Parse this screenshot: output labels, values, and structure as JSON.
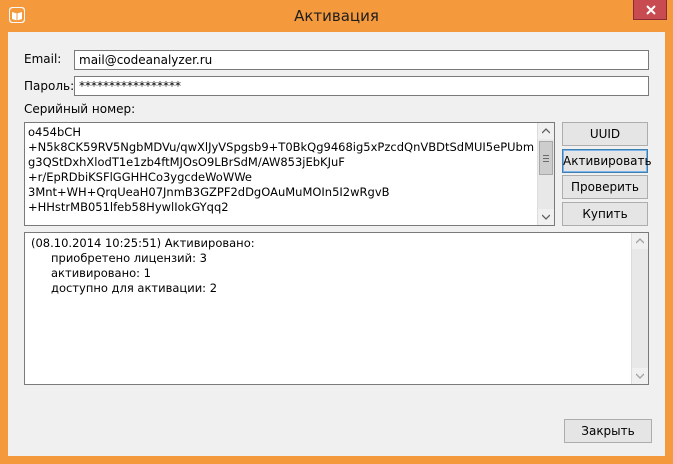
{
  "window": {
    "title": "Активация",
    "accent_color": "#f59a3c",
    "app_icon": "book-icon",
    "close_icon": "close-icon"
  },
  "form": {
    "email_label": "Email:",
    "email_value": "mail@codeanalyzer.ru",
    "password_label": "Пароль:",
    "password_value": "*****************",
    "serial_label": "Серийный номер:",
    "serial_lines": [
      "o454bCH",
      "+N5k8CK59RV5NgbMDVu/qwXlJyVSpgsb9+T0BkQg9468ig5xPzcdQnVBDtSdMUI5ePUbm",
      "g3QStDxhXlodT1e1zb4ftMJOsO9LBrSdM/AW853jEbKJuF",
      "+r/EpRDbiKSFlGGHHCo3ygcdeWoWWe",
      "3Mnt+WH+QrqUeaH07JnmB3GZPF2dDgOAuMuMOIn5I2wRgvB",
      "+HHstrMB051lfeb58HywlIokGYqq2"
    ]
  },
  "buttons": {
    "uuid": "UUID",
    "activate": "Активировать",
    "check": "Проверить",
    "buy": "Купить",
    "close": "Закрыть"
  },
  "log": {
    "header": "(08.10.2014 10:25:51) Активировано:",
    "lines": [
      "приобретено лицензий: 3",
      "активировано: 1",
      "доступно для активации: 2"
    ]
  }
}
